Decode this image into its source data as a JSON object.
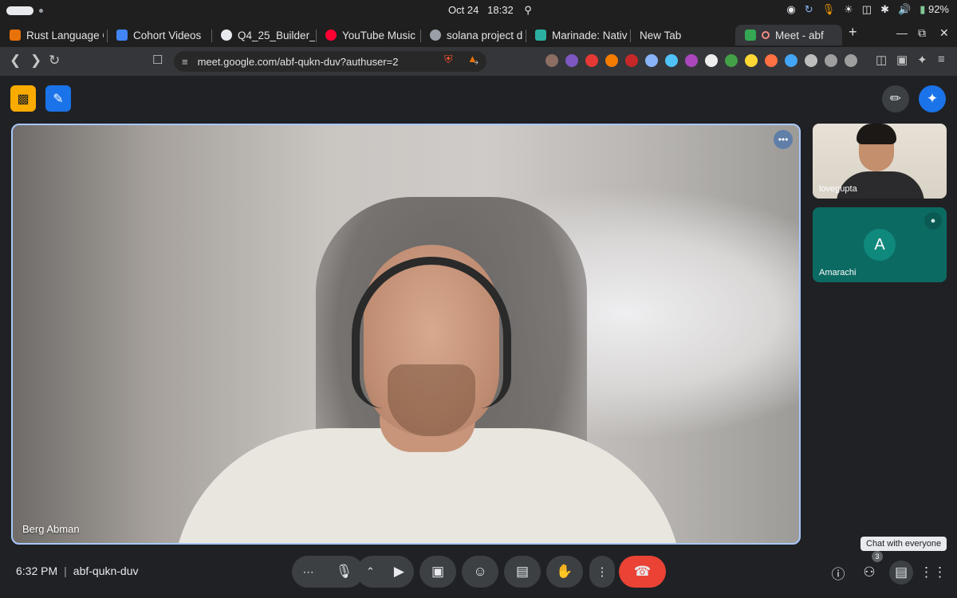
{
  "status_bar": {
    "date": "Oct 24",
    "time": "18:32",
    "battery": "92%"
  },
  "tabs": [
    {
      "label": "Rust Language C",
      "color": "#e8710a"
    },
    {
      "label": "Cohort Videos",
      "color": "#4285f4"
    },
    {
      "label": "Q4_25_Builder_",
      "color": "#e8eaed"
    },
    {
      "label": "YouTube Music",
      "color": "#ff0033"
    },
    {
      "label": "solana project d",
      "color": "#9aa0a6"
    },
    {
      "label": "Marinade: Nativ",
      "color": "#2bb0a0"
    },
    {
      "label": "New Tab",
      "color": ""
    },
    {
      "label": "Meet - abf",
      "color": "#34a853"
    }
  ],
  "toolbar": {
    "url": "meet.google.com/abf-qukn-duv?authuser=2"
  },
  "main_participant": {
    "name": "Berg Abman"
  },
  "participants": [
    {
      "name": "lovegupta"
    },
    {
      "name": "Amarachi",
      "initial": "A"
    }
  ],
  "meeting": {
    "time": "6:32 PM",
    "code": "abf-qukn-duv"
  },
  "people_count": "3",
  "tooltip": "Chat with everyone"
}
